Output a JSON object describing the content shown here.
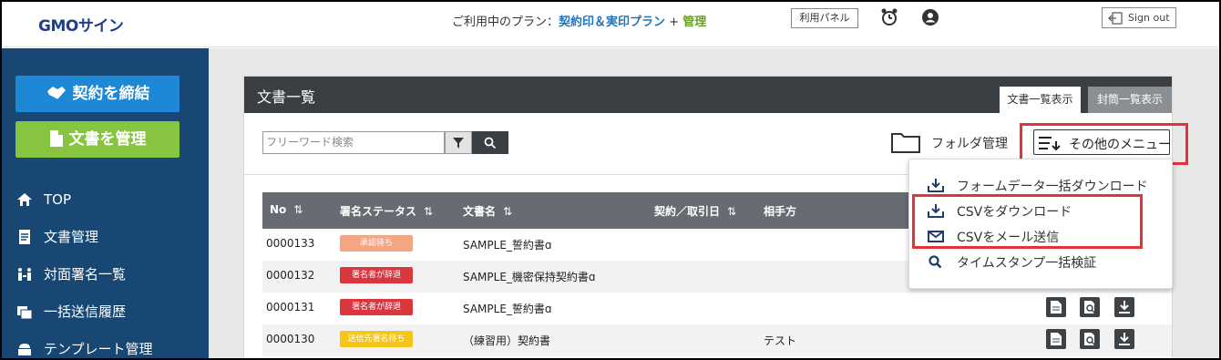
{
  "header": {
    "logo": "GMOサイン",
    "plan_prefix": "ご利用中のプラン：",
    "plan_name": "契約印＆実印プラン",
    "plan_plus": " + ",
    "plan_admin": "管理",
    "panel_button": "利用パネル",
    "signout": "Sign out"
  },
  "sidebar": {
    "contract_button": "契約を締結",
    "manage_button": "文書を管理",
    "items": [
      {
        "label": "TOP",
        "icon": "home-icon"
      },
      {
        "label": "文書管理",
        "icon": "document-icon"
      },
      {
        "label": "対面署名一覧",
        "icon": "face-to-face-icon"
      },
      {
        "label": "一括送信履歴",
        "icon": "bulk-send-icon"
      },
      {
        "label": "テンプレート管理",
        "icon": "template-icon"
      }
    ]
  },
  "main": {
    "title": "文書一覧",
    "tabs": [
      {
        "label": "文書一覧表示",
        "active": true
      },
      {
        "label": "封筒一覧表示",
        "active": false
      }
    ],
    "search_placeholder": "フリーワード検索",
    "folder_label": "フォルダ管理",
    "other_menu_label": "その他のメニュー",
    "table": {
      "columns": [
        "No",
        "署名ステータス",
        "文書名",
        "契約／取引日",
        "相手方"
      ],
      "rows": [
        {
          "no": "0000133",
          "status": "承認待ち",
          "status_color": "#f4a582",
          "name": "SAMPLE_誓約書ɑ",
          "partner": ""
        },
        {
          "no": "0000132",
          "status": "署名者が辞退",
          "status_color": "#d9363e",
          "name": "SAMPLE_機密保持契約書ɑ",
          "partner": ""
        },
        {
          "no": "0000131",
          "status": "署名者が辞退",
          "status_color": "#d9363e",
          "name": "SAMPLE_誓約書ɑ",
          "partner": ""
        },
        {
          "no": "0000130",
          "status": "送信先署名待ち",
          "status_color": "#f5c518",
          "name": "（練習用）契約書",
          "partner": "テスト"
        }
      ]
    }
  },
  "dropdown": {
    "items": [
      {
        "label": "フォームデータ一括ダウンロード",
        "icon": "download-icon"
      },
      {
        "label": "CSVをダウンロード",
        "icon": "download-icon"
      },
      {
        "label": "CSVをメール送信",
        "icon": "mail-icon"
      },
      {
        "label": "タイムスタンプ一括検証",
        "icon": "search-icon"
      }
    ]
  }
}
